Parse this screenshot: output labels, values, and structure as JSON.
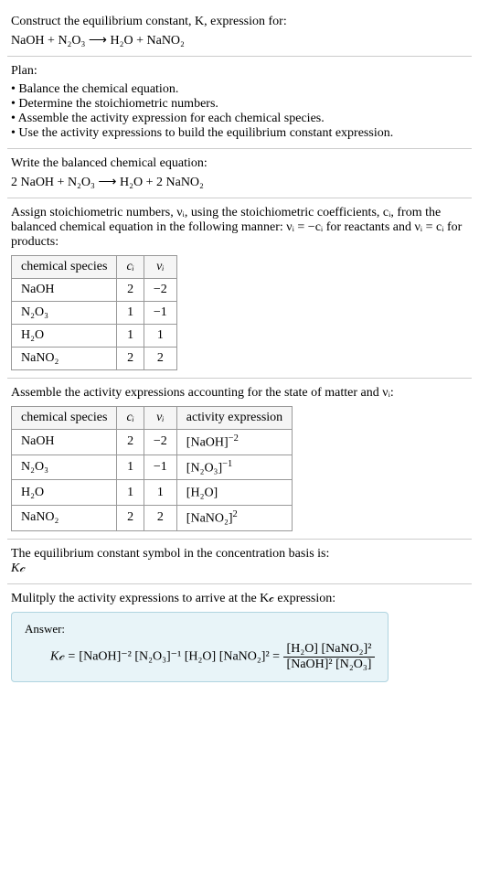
{
  "intro": {
    "line1": "Construct the equilibrium constant, K, expression for:",
    "equation": "NaOH + N₂O₃ ⟶ H₂O + NaNO₂"
  },
  "plan": {
    "title": "Plan:",
    "items": [
      "Balance the chemical equation.",
      "Determine the stoichiometric numbers.",
      "Assemble the activity expression for each chemical species.",
      "Use the activity expressions to build the equilibrium constant expression."
    ]
  },
  "balanced": {
    "title": "Write the balanced chemical equation:",
    "equation": "2 NaOH + N₂O₃ ⟶ H₂O + 2 NaNO₂"
  },
  "stoich_intro": "Assign stoichiometric numbers, νᵢ, using the stoichiometric coefficients, cᵢ, from the balanced chemical equation in the following manner: νᵢ = −cᵢ for reactants and νᵢ = cᵢ for products:",
  "table1": {
    "headers": [
      "chemical species",
      "cᵢ",
      "νᵢ"
    ],
    "rows": [
      [
        "NaOH",
        "2",
        "−2"
      ],
      [
        "N₂O₃",
        "1",
        "−1"
      ],
      [
        "H₂O",
        "1",
        "1"
      ],
      [
        "NaNO₂",
        "2",
        "2"
      ]
    ]
  },
  "activity_intro": "Assemble the activity expressions accounting for the state of matter and νᵢ:",
  "table2": {
    "headers": [
      "chemical species",
      "cᵢ",
      "νᵢ",
      "activity expression"
    ],
    "rows": [
      {
        "species": "NaOH",
        "c": "2",
        "v": "−2",
        "expr_base": "[NaOH]",
        "expr_exp": "−2"
      },
      {
        "species": "N₂O₃",
        "c": "1",
        "v": "−1",
        "expr_base": "[N₂O₃]",
        "expr_exp": "−1"
      },
      {
        "species": "H₂O",
        "c": "1",
        "v": "1",
        "expr_base": "[H₂O]",
        "expr_exp": ""
      },
      {
        "species": "NaNO₂",
        "c": "2",
        "v": "2",
        "expr_base": "[NaNO₂]",
        "expr_exp": "2"
      }
    ]
  },
  "eq_const": {
    "line1": "The equilibrium constant symbol in the concentration basis is:",
    "symbol": "K𝒸"
  },
  "multiply_intro": "Mulitply the activity expressions to arrive at the K𝒸 expression:",
  "answer": {
    "label": "Answer:",
    "lhs": "K𝒸 = ",
    "flat": "[NaOH]⁻² [N₂O₃]⁻¹ [H₂O] [NaNO₂]² = ",
    "frac_num": "[H₂O] [NaNO₂]²",
    "frac_den": "[NaOH]² [N₂O₃]"
  }
}
